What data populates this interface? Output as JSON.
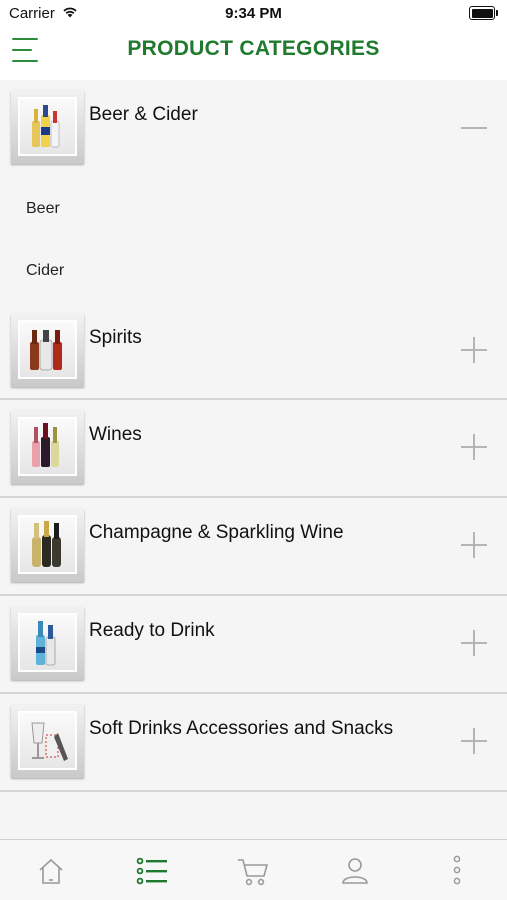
{
  "status_bar": {
    "carrier": "Carrier",
    "time": "9:34 PM"
  },
  "nav": {
    "title": "PRODUCT CATEGORIES"
  },
  "categories": [
    {
      "label": "Beer & Cider",
      "expanded": true,
      "icon": "beer-bottles-image",
      "subcategories": [
        "Beer",
        "Cider"
      ]
    },
    {
      "label": "Spirits",
      "expanded": false,
      "icon": "spirits-bottles-image"
    },
    {
      "label": "Wines",
      "expanded": false,
      "icon": "wine-bottles-image"
    },
    {
      "label": "Champagne & Sparkling Wine",
      "expanded": false,
      "icon": "champagne-bottles-image"
    },
    {
      "label": "Ready to Drink",
      "expanded": false,
      "icon": "rtd-bottles-image"
    },
    {
      "label": "Soft Drinks Accessories  and Snacks",
      "expanded": false,
      "icon": "accessories-image"
    }
  ],
  "tab_bar": {
    "items": [
      "home-icon",
      "categories-list-icon",
      "cart-icon",
      "account-icon",
      "more-icon"
    ],
    "active": "categories-list-icon",
    "active_color": "#1f7a2e",
    "inactive_color": "#9a9a9a"
  },
  "colors": {
    "brand_green": "#1f7a2e",
    "background": "#f5f5f5",
    "divider": "#d6d6d6"
  }
}
